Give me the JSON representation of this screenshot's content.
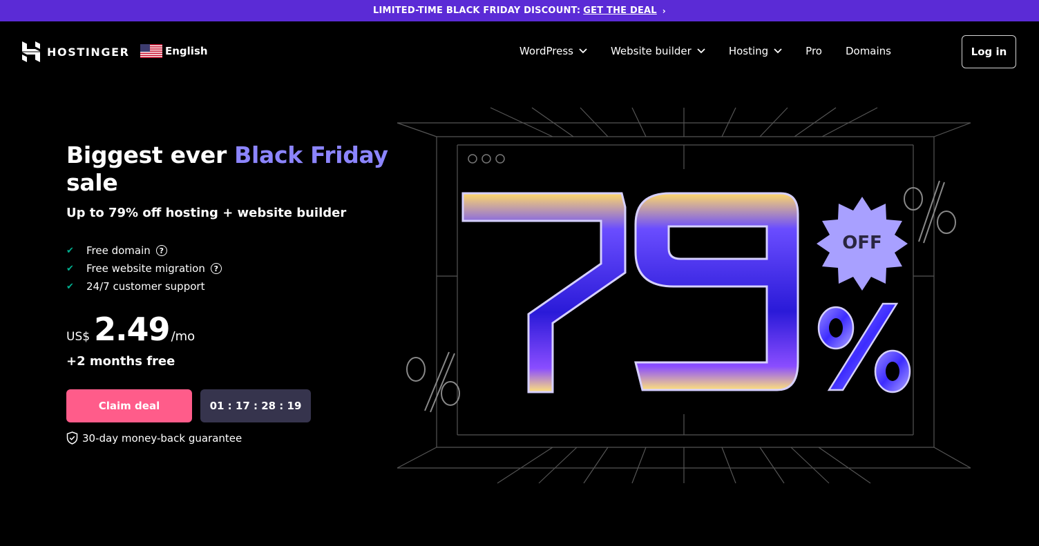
{
  "promo": {
    "text": "LIMITED-TIME BLACK FRIDAY DISCOUNT:",
    "link": "GET THE DEAL",
    "chevron": "›"
  },
  "header": {
    "brand": "HOSTINGER",
    "language": "English",
    "nav": [
      {
        "label": "WordPress",
        "has_dropdown": true
      },
      {
        "label": "Website builder",
        "has_dropdown": true
      },
      {
        "label": "Hosting",
        "has_dropdown": true
      },
      {
        "label": "Pro",
        "has_dropdown": false
      },
      {
        "label": "Domains",
        "has_dropdown": false
      }
    ],
    "login": "Log in"
  },
  "hero": {
    "headline_part1": "Biggest ever",
    "headline_accent": "Black Friday",
    "headline_part2": "sale",
    "subhead": "Up to 79% off hosting + website builder",
    "features": [
      {
        "label": "Free domain",
        "help": true
      },
      {
        "label": "Free website migration",
        "help": true
      },
      {
        "label": "24/7 customer support",
        "help": false
      }
    ],
    "price_currency": "US$",
    "price_amount": "2.49",
    "price_period": "/mo",
    "bonus": "+2 months free",
    "cta": "Claim deal",
    "countdown": "01 : 17 : 28 : 19",
    "guarantee": "30-day money-back guarantee"
  },
  "art": {
    "big_number": "79",
    "percent": "%",
    "badge": "OFF"
  },
  "colors": {
    "promo_bg": "#5b2bd6",
    "accent_text": "#8c85ff",
    "cta_bg": "#ff5c8a",
    "timer_bg": "#36344d",
    "check": "#00b090",
    "background": "#000000"
  }
}
